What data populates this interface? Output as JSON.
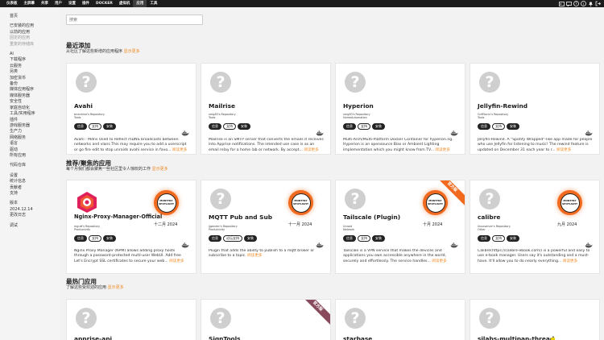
{
  "nav": {
    "items": [
      {
        "label": "仪表板"
      },
      {
        "label": "主屏幕"
      },
      {
        "label": "共享"
      },
      {
        "label": "用户"
      },
      {
        "label": "设置"
      },
      {
        "label": "插件"
      },
      {
        "label": "DOCKER"
      },
      {
        "label": "虚拟机"
      },
      {
        "label": "应用"
      },
      {
        "label": "工具"
      }
    ],
    "active_index": 8
  },
  "sidebar": {
    "groups": [
      [
        {
          "label": "首页",
          "muted": false
        }
      ],
      [
        {
          "label": "已安装的应用",
          "muted": false
        },
        {
          "label": "以前的应用",
          "muted": false
        },
        {
          "label": "固定的应用",
          "muted": true
        },
        {
          "label": "重复的存储库",
          "muted": true
        }
      ],
      [
        {
          "label": "AI",
          "muted": false
        },
        {
          "label": "下载程序",
          "muted": false
        },
        {
          "label": "云服务",
          "muted": false
        },
        {
          "label": "另类",
          "muted": false
        },
        {
          "label": "加密货币",
          "muted": false
        },
        {
          "label": "备份",
          "muted": false
        },
        {
          "label": "媒体应用程序",
          "muted": false
        },
        {
          "label": "媒体服务器",
          "muted": false
        },
        {
          "label": "安全性",
          "muted": false
        },
        {
          "label": "家庭自动化",
          "muted": false
        },
        {
          "label": "工具/实用程序",
          "muted": false
        },
        {
          "label": "插件",
          "muted": false
        },
        {
          "label": "游戏服务器",
          "muted": false
        },
        {
          "label": "生产力",
          "muted": false
        },
        {
          "label": "网络服务",
          "muted": false
        },
        {
          "label": "语言",
          "muted": false
        },
        {
          "label": "驱动",
          "muted": false
        },
        {
          "label": "所有应用",
          "muted": false
        }
      ],
      [
        {
          "label": "代码仓库",
          "muted": false
        }
      ],
      [
        {
          "label": "设置",
          "muted": false
        },
        {
          "label": "统计信息",
          "muted": false
        },
        {
          "label": "贡献者",
          "muted": false
        },
        {
          "label": "支持",
          "muted": false
        }
      ],
      [
        {
          "label": "版本",
          "muted": false
        },
        {
          "label": "2024.12.14",
          "muted": false
        },
        {
          "label": "更改日志",
          "muted": false
        }
      ],
      [
        {
          "label": "调试",
          "muted": false
        }
      ]
    ]
  },
  "search": {
    "placeholder": "搜索"
  },
  "buttons": {
    "info": "信息",
    "support": "支持",
    "install": "安装",
    "discuss": "论坛支持"
  },
  "more_link": "阅读更多",
  "sections": {
    "recent": {
      "title": "最近添加",
      "subtitle": "从社区了解这些新增的应用程序",
      "more": "显示更多",
      "cards": [
        {
          "name": "Avahi",
          "repo": "brianhine's Repository",
          "category": "Tools",
          "support": "支持",
          "description": "Avahi - Mdns Used to Reflect mDNS broadcasts between networks and vlans This may require you to add a userscript or go fire edit to stop unraids avahi service in favo..."
        },
        {
          "name": "Mailrise",
          "repo": "xmg83's Repository",
          "category": "Tools",
          "support": "支持",
          "description": "Mailrise is an SMTP server that converts the emails it receives into Apprise notifications. The intended use case is as an email relay for a home lab or network. By accept..."
        },
        {
          "name": "Hyperion",
          "repo": "xmg83's Repository",
          "category": "HomeAutomation",
          "support": "支持",
          "description": "Multi-Arch/Multi-Platform Docker Container for hyperion.ng. Hyperion is an opensource Bias or Ambient Lighting implementation which you might know from TV..."
        },
        {
          "name": "Jellyfin-Rewind",
          "repo": "GnRSonic's Repository",
          "category": "Tools",
          "support": "支持",
          "description": "Jellyfin-Rewind. A \"Spotify Wrapped\"-like app made for people who use Jellyfin for listening to music! The rewind feature is updated on December 31 each year to r..."
        }
      ]
    },
    "spotlight": {
      "title": "推荐/聚焦的应用",
      "subtitle": "每个月我们都会聚焦一些社区里令人惊叹的工作",
      "more": "显示更多",
      "badge": [
        "MONTHLY",
        "SPOTLIGHT"
      ],
      "ribbon": "官方版",
      "cards": [
        {
          "name": "Nginx-Proxy-Manager-Official",
          "repo": "mgutt's Repository",
          "category": "Productivity",
          "date": "十二月 2024",
          "support": "支持",
          "official": false,
          "description": "Nginx Proxy Manager (NPM) allows adding proxy hosts through a password-protected multi-user WebUI. Add free Let's Encrypt SSL certificates to secure your web..."
        },
        {
          "name": "MQTT Pub and Sub",
          "repo": "jjgender's Repository",
          "category": "Productivity",
          "date": "十一月 2024",
          "support": "论坛支持",
          "official": false,
          "description": "Plugin that adds the ability to publish to a mqtt broker or subscribe to a topic."
        },
        {
          "name": "Tailscale (Plugin)",
          "repo": "Unraid",
          "category": "Network",
          "date": "十月 2024",
          "support": "支持",
          "official": true,
          "description": "Tailscale is a VPN service that makes the devices and applications you own accessible anywhere in the world, securely and effortlessly. The service handles..."
        },
        {
          "name": "calibre",
          "repo": "linuxserver's Repository",
          "category": "Other",
          "date": "九月 2024",
          "support": "支持",
          "official": false,
          "description": "Calibre(https://calibre-ebook.com/) is a powerful and easy to use e-book manager. Users say it's outstanding and a must-have. It'll allow you to do nearly everything..."
        }
      ]
    },
    "popular": {
      "title": "最热门应用",
      "subtitle": "了解这些受欢迎的应用",
      "more": "显示更多",
      "ribbon": "官方版",
      "cards": [
        {
          "name": "apprise-api",
          "official": false
        },
        {
          "name": "SignTools",
          "official": true
        },
        {
          "name": "starbase",
          "official": false
        },
        {
          "name": "silabs-multipan-thread",
          "official": false
        }
      ]
    }
  },
  "colors": {
    "accent": "#f08a24",
    "spotlight": "#f26a1e",
    "ribbon": "#f26a1e",
    "ribbon_alt": "#8a4a5e",
    "topbar": "#1c1c1c"
  }
}
